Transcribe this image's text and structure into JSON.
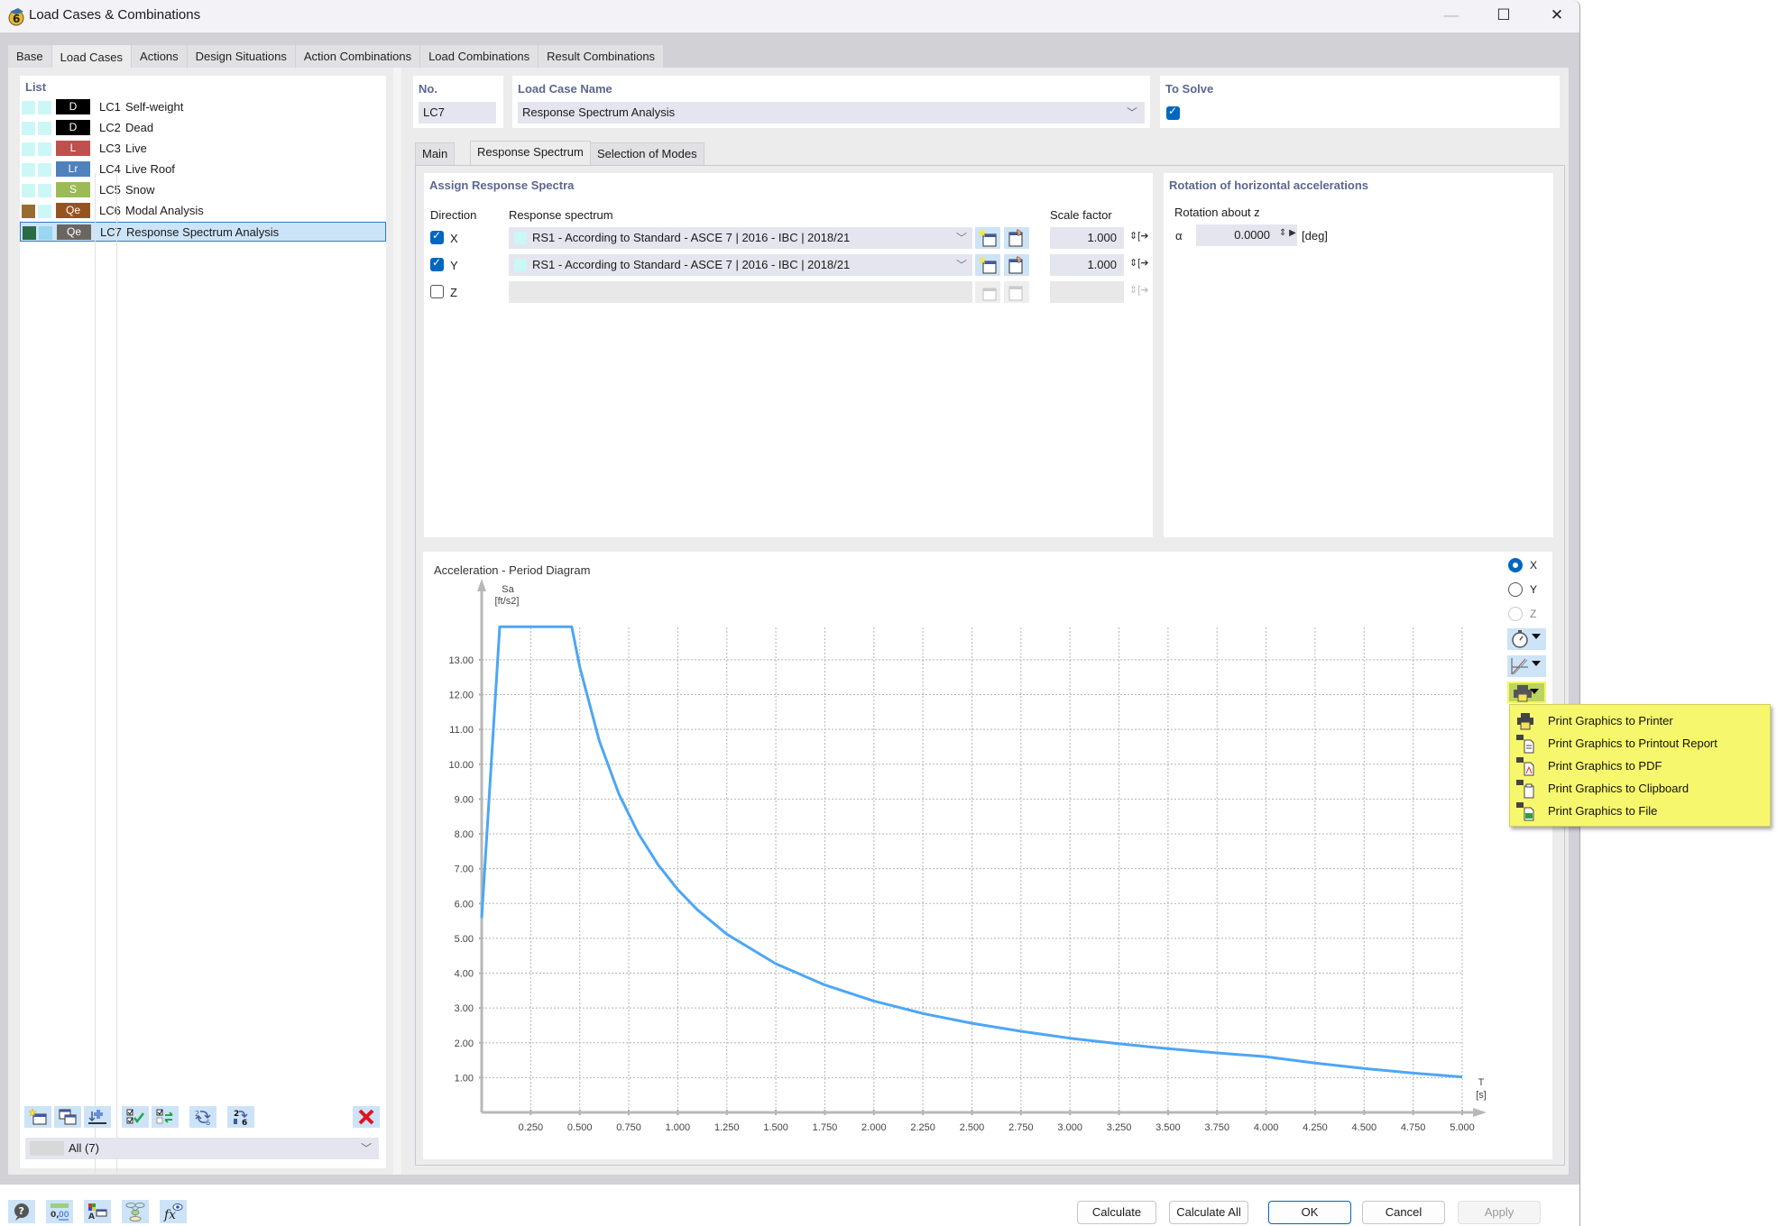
{
  "window": {
    "title": "Load Cases & Combinations",
    "controls": {
      "minimize": "—",
      "maximize": "☐",
      "close": "✕"
    }
  },
  "top_tabs": [
    {
      "label": "Base",
      "active": false
    },
    {
      "label": "Load Cases",
      "active": true
    },
    {
      "label": "Actions",
      "active": false
    },
    {
      "label": "Design Situations",
      "active": false
    },
    {
      "label": "Action Combinations",
      "active": false
    },
    {
      "label": "Load Combinations",
      "active": false
    },
    {
      "label": "Result Combinations",
      "active": false
    }
  ],
  "list": {
    "header": "List",
    "items": [
      {
        "no": "LC1",
        "name": "Self-weight",
        "badge": "D",
        "badge_color": "#000000",
        "swatch1": "#ccf7f7",
        "swatch2": "#ccf7f7",
        "selected": false
      },
      {
        "no": "LC2",
        "name": "Dead",
        "badge": "D",
        "badge_color": "#000000",
        "swatch1": "#ccf7f7",
        "swatch2": "#ccf7f7",
        "selected": false
      },
      {
        "no": "LC3",
        "name": "Live",
        "badge": "L",
        "badge_color": "#c0504d",
        "swatch1": "#ccf7f7",
        "swatch2": "#ccf7f7",
        "selected": false
      },
      {
        "no": "LC4",
        "name": "Live Roof",
        "badge": "Lr",
        "badge_color": "#4f81bd",
        "swatch1": "#ccf7f7",
        "swatch2": "#ccf7f7",
        "selected": false
      },
      {
        "no": "LC5",
        "name": "Snow",
        "badge": "S",
        "badge_color": "#9bbb59",
        "swatch1": "#ccf7f7",
        "swatch2": "#ccf7f7",
        "selected": false
      },
      {
        "no": "LC6",
        "name": "Modal Analysis",
        "badge": "Qe",
        "badge_color": "#97531f",
        "swatch1": "#986c31",
        "swatch2": "#ccf7f7",
        "selected": false
      },
      {
        "no": "LC7",
        "name": "Response Spectrum Analysis",
        "badge": "Qe",
        "badge_color": "#6b6560",
        "swatch1": "#2a6b45",
        "swatch2": "#99d6f0",
        "selected": true
      }
    ],
    "toolbar_icons": [
      "new-icon",
      "copy-icon",
      "import-icon",
      "check-all-icon",
      "toggle-check-icon",
      "renumber-icon",
      "reorder-icon",
      "delete-icon"
    ],
    "filter": {
      "label": "All (7)"
    }
  },
  "header": {
    "no_label": "No.",
    "no_value": "LC7",
    "name_label": "Load Case Name",
    "name_value": "Response Spectrum Analysis",
    "to_solve_label": "To Solve",
    "to_solve_checked": true
  },
  "sub_tabs": [
    {
      "label": "Main",
      "active": false
    },
    {
      "label": "Response Spectrum",
      "active": true
    },
    {
      "label": "Selection of Modes",
      "active": false
    }
  ],
  "assign": {
    "title": "Assign Response Spectra",
    "col_direction": "Direction",
    "col_spectrum": "Response spectrum",
    "col_scale": "Scale factor",
    "rows": [
      {
        "dir": "X",
        "checked": true,
        "spectrum": "RS1 - According to Standard - ASCE 7 | 2016 - IBC | 2018/21",
        "scale": "1.000"
      },
      {
        "dir": "Y",
        "checked": true,
        "spectrum": "RS1 - According to Standard - ASCE 7 | 2016 - IBC | 2018/21",
        "scale": "1.000"
      },
      {
        "dir": "Z",
        "checked": false,
        "spectrum": "",
        "scale": ""
      }
    ]
  },
  "rotation": {
    "title": "Rotation of horizontal accelerations",
    "sub_label": "Rotation about z",
    "symbol": "α",
    "value": "0.0000",
    "unit": "[deg]"
  },
  "chart_controls": {
    "radios": [
      {
        "label": "X",
        "state": "selected"
      },
      {
        "label": "Y",
        "state": "unselected"
      },
      {
        "label": "Z",
        "state": "disabled"
      }
    ],
    "buttons": [
      "timer-icon",
      "graph-options-icon",
      "print-icon"
    ]
  },
  "print_menu": {
    "items": [
      {
        "label": "Print Graphics to Printer",
        "icon": "printer-icon"
      },
      {
        "label": "Print Graphics to Printout Report",
        "icon": "printout-report-icon"
      },
      {
        "label": "Print Graphics to PDF",
        "icon": "pdf-icon"
      },
      {
        "label": "Print Graphics to Clipboard",
        "icon": "clipboard-icon"
      },
      {
        "label": "Print Graphics to File",
        "icon": "file-icon"
      }
    ]
  },
  "chart_data": {
    "type": "line",
    "title": "Acceleration - Period Diagram",
    "xlabel": "T",
    "xunit": "[s]",
    "ylabel": "Sa",
    "yunit": "[ft/s2]",
    "xlim": [
      0,
      5.0
    ],
    "ylim": [
      0,
      14.5
    ],
    "grid": true,
    "x_ticks": [
      0.25,
      0.5,
      0.75,
      1.0,
      1.25,
      1.5,
      1.75,
      2.0,
      2.25,
      2.5,
      2.75,
      3.0,
      3.25,
      3.5,
      3.75,
      4.0,
      4.25,
      4.5,
      4.75,
      5.0
    ],
    "x_tick_labels": [
      "0.250",
      "0.500",
      "0.750",
      "1.000",
      "1.250",
      "1.500",
      "1.750",
      "2.000",
      "2.250",
      "2.500",
      "2.750",
      "3.000",
      "3.250",
      "3.500",
      "3.750",
      "4.000",
      "4.250",
      "4.500",
      "4.750",
      "5.000"
    ],
    "y_ticks": [
      1,
      2,
      3,
      4,
      5,
      6,
      7,
      8,
      9,
      10,
      11,
      12,
      13
    ],
    "y_tick_labels": [
      "1.00",
      "2.00",
      "3.00",
      "4.00",
      "5.00",
      "6.00",
      "7.00",
      "8.00",
      "9.00",
      "10.00",
      "11.00",
      "12.00",
      "13.00"
    ],
    "series": [
      {
        "name": "Sa",
        "color": "#4da6f5",
        "x": [
          0,
          0.092,
          0.459,
          0.5,
          0.6,
          0.7,
          0.8,
          0.9,
          1.0,
          1.1,
          1.25,
          1.5,
          1.75,
          2.0,
          2.25,
          2.5,
          2.75,
          3.0,
          3.25,
          3.5,
          3.75,
          4.0,
          4.25,
          4.5,
          4.75,
          5.0
        ],
        "y": [
          5.58,
          13.95,
          13.95,
          12.8,
          10.67,
          9.14,
          8.0,
          7.11,
          6.4,
          5.82,
          5.12,
          4.27,
          3.66,
          3.2,
          2.84,
          2.56,
          2.33,
          2.13,
          1.97,
          1.83,
          1.71,
          1.6,
          1.42,
          1.26,
          1.13,
          1.02
        ]
      }
    ]
  },
  "bottom": {
    "icons": [
      "help-icon",
      "units-icon",
      "display-icon",
      "model-icon",
      "formula-icon"
    ],
    "buttons": {
      "calculate": "Calculate",
      "calculate_all": "Calculate All",
      "ok": "OK",
      "cancel": "Cancel",
      "apply": "Apply"
    }
  }
}
